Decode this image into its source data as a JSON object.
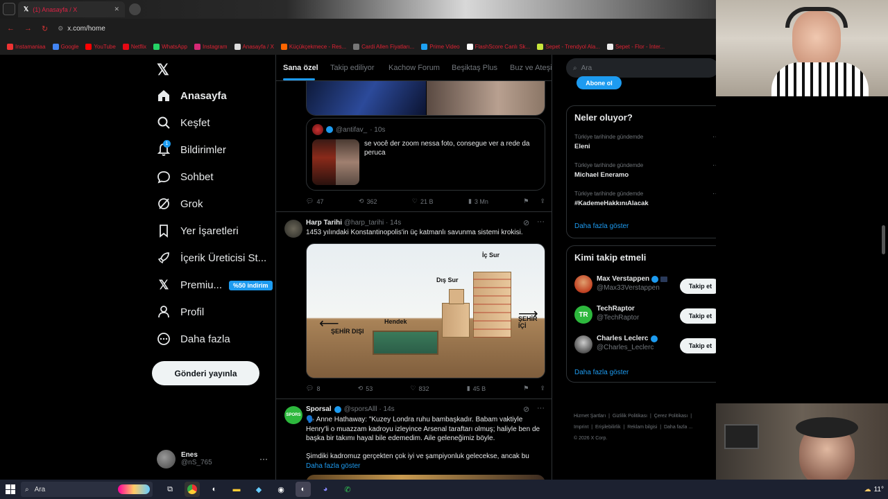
{
  "browser": {
    "tabs": [
      {
        "label": "(1) Anasayfa / X"
      }
    ],
    "url": "x.com/home",
    "bookmarks": [
      "Instamaniaa",
      "Google",
      "YouTube",
      "Netflix",
      "WhatsApp",
      "Instagram",
      "Anasayfa / X",
      "Küçükçekmece - Res...",
      "Cardi Allen Fiyatları...",
      "Prime Video",
      "FlashScore Canlı Sk...",
      "Sepet - Trendyol Ala...",
      "Sepet - Flor - İnter..."
    ]
  },
  "sidebar": {
    "items": [
      {
        "label": "Anasayfa"
      },
      {
        "label": "Keşfet"
      },
      {
        "label": "Bildirimler",
        "badge": "1"
      },
      {
        "label": "Sohbet"
      },
      {
        "label": "Grok"
      },
      {
        "label": "Yer İşaretleri"
      },
      {
        "label": "İçerik Üreticisi St..."
      },
      {
        "label": "Premiu...",
        "badge": "%50 indirim"
      },
      {
        "label": "Profil"
      },
      {
        "label": "Daha fazla"
      }
    ],
    "post_button": "Gönderi yayınla",
    "account": {
      "name": "Enes",
      "handle": "@nS_765"
    }
  },
  "feed": {
    "tabs": [
      "Sana özel",
      "Takip ediliyor",
      "Kachow Forum",
      "Beşiktaş Plus",
      "Buz ve Ateşin"
    ],
    "quoted": {
      "handle": "@antifav_",
      "time": "· 10s",
      "text": "se você der zoom nessa foto, consegue ver a rede da peruca"
    },
    "post1_stats": {
      "replies": "47",
      "reposts": "362",
      "likes": "21 B",
      "views": "3 Mn"
    },
    "post2": {
      "name": "Harp Tarihi",
      "handle": "@harp_tarihi · 14s",
      "text": "1453 yılındaki Konstantinopolis'in üç katmanlı savunma sistemi krokisi.",
      "image_labels": {
        "left": "ŞEHİR DIŞI",
        "right": "ŞEHİR İÇİ",
        "hendek": "Hendek",
        "dis_sur": "Dış Sur",
        "ic_sur": "İç Sur"
      },
      "stats": {
        "replies": "8",
        "reposts": "53",
        "likes": "832",
        "views": "45 B"
      }
    },
    "post3": {
      "name": "Sporsal",
      "handle": "@sporsAlll · 14s",
      "text": "🗣️ Anne Hathaway: \"Kuzey Londra ruhu bambaşkadır. Babam vaktiyle Henry'li o muazzam kadroyu izleyince Arsenal taraftarı olmuş; haliyle ben de başka bir takımı hayal bile edemedim. Aile geleneğimiz böyle.",
      "text2": "Şimdiki kadromuz gerçekten çok iyi ve şampiyonluk gelecekse, ancak bu",
      "more": "Daha fazla göster"
    }
  },
  "right": {
    "search_placeholder": "Ara",
    "subscribe": "Abone ol",
    "trends_title": "Neler oluyor?",
    "trends": [
      {
        "context": "Türkiye tarihinde gündemde",
        "name": "Eleni"
      },
      {
        "context": "Türkiye tarihinde gündemde",
        "name": "Michael Eneramo"
      },
      {
        "context": "Türkiye tarihinde gündemde",
        "name": "#KademeHakkınıAlacak"
      }
    ],
    "trends_more": "Daha fazla göster",
    "who_title": "Kimi takip etmeli",
    "who": [
      {
        "name": "Max Verstappen",
        "handle": "@Max33Verstappen",
        "button": "Takip et"
      },
      {
        "name": "TechRaptor",
        "handle": "@TechRaptor",
        "button": "Takip et"
      },
      {
        "name": "Charles Leclerc",
        "handle": "@Charles_Leclerc",
        "button": "Takip et"
      }
    ],
    "who_more": "Daha fazla göster",
    "footer": [
      "Hizmet Şartları",
      "Gizlilik Politikası",
      "Çerez Politikası",
      "Imprint",
      "Erişilebilirlik",
      "Reklam bilgisi",
      "Daha fazla ...",
      "© 2026 X Corp."
    ]
  },
  "taskbar": {
    "search": "Ara",
    "temp": "11°"
  },
  "colors": {
    "accent": "#1d9bf0",
    "bg": "#000000",
    "border": "#2f3336"
  }
}
